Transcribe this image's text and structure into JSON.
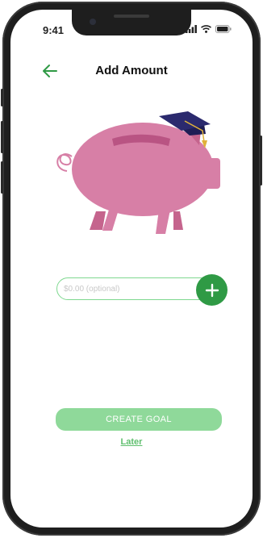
{
  "status_bar": {
    "time": "9:41",
    "icons": [
      "cellular-signal-icon",
      "wifi-icon",
      "battery-icon"
    ]
  },
  "header": {
    "back_icon": "arrow-left-icon",
    "title": "Add Amount"
  },
  "illustration": {
    "subject": "piggy-bank-with-graduation-cap"
  },
  "amount_field": {
    "value": "",
    "placeholder": "$0.00 (optional)",
    "add_icon": "plus-icon"
  },
  "actions": {
    "create_goal_label": "CREATE GOAL",
    "later_label": "Later"
  },
  "colors": {
    "accent_green": "#2f9a45",
    "input_border_green": "#7ed88f",
    "button_green_light": "#8fd99a",
    "link_green": "#5fbf6e",
    "piggy_pink": "#d77fa6",
    "cap_navy": "#2b2a6e"
  }
}
